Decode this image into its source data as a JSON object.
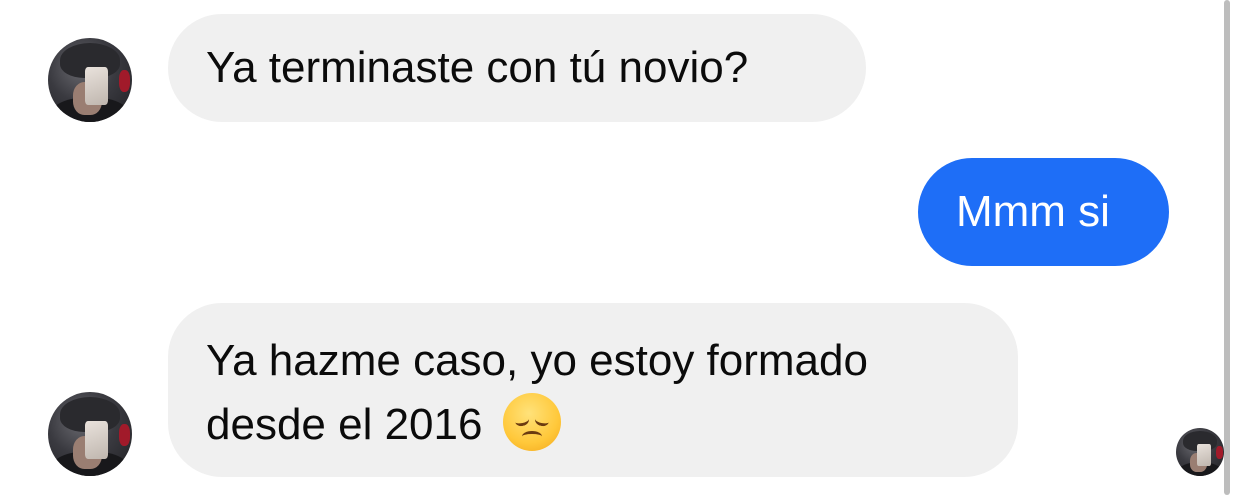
{
  "messages": [
    {
      "direction": "incoming",
      "text": "Ya terminaste con tú novio?"
    },
    {
      "direction": "outgoing",
      "text": "Mmm si"
    },
    {
      "direction": "incoming",
      "lines": [
        "Ya hazme caso, yo estoy formado",
        "desde el 2016"
      ],
      "emoji": "disappointed-face-emoji"
    }
  ],
  "colors": {
    "incoming_bubble": "#f0f0f0",
    "outgoing_bubble": "#1e6ef7",
    "outgoing_text": "#ffffff",
    "text": "#0b0b0b"
  },
  "icons": {
    "contact_avatar": "contact-avatar",
    "read_receipt": "read-receipt-avatar"
  }
}
